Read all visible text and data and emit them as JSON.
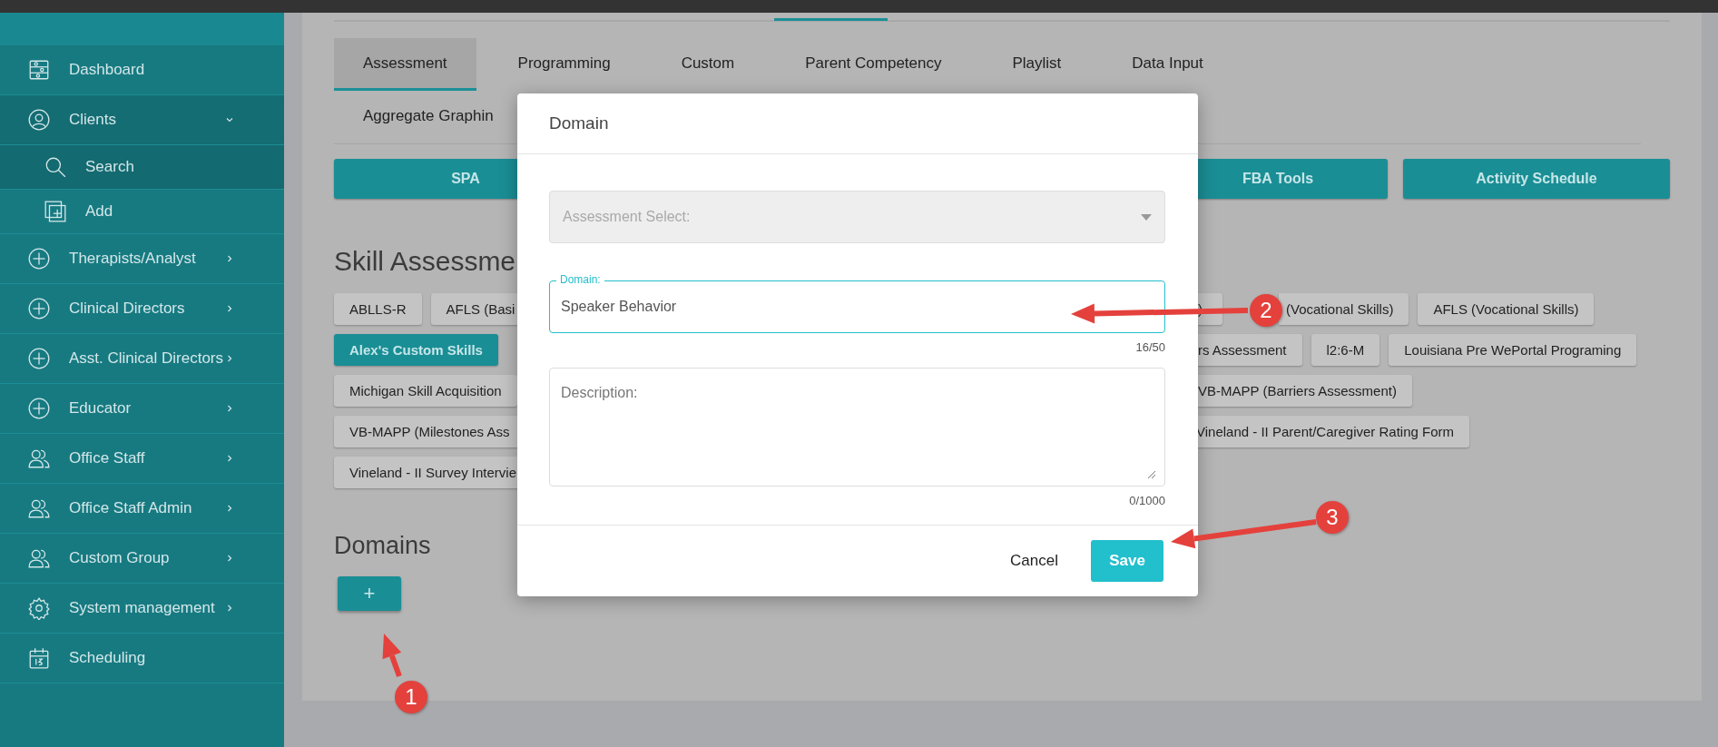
{
  "sidebar": {
    "items": [
      {
        "label": "Dashboard"
      },
      {
        "label": "Clients",
        "expanded": true,
        "children": [
          {
            "label": "Search",
            "selected": true
          },
          {
            "label": "Add",
            "selected": false
          }
        ]
      },
      {
        "label": "Therapists/Analyst",
        "expanded": false
      },
      {
        "label": "Clinical Directors",
        "expanded": false
      },
      {
        "label": "Asst. Clinical Directors",
        "expanded": false
      },
      {
        "label": "Educator",
        "expanded": false
      },
      {
        "label": "Office Staff",
        "expanded": false
      },
      {
        "label": "Office Staff Admin",
        "expanded": false
      },
      {
        "label": "Custom Group",
        "expanded": false
      },
      {
        "label": "System management",
        "expanded": false
      },
      {
        "label": "Scheduling"
      }
    ]
  },
  "tabs": [
    {
      "label": "Assessment",
      "selected": true
    },
    {
      "label": "Programming",
      "selected": false
    },
    {
      "label": "Custom",
      "selected": false
    },
    {
      "label": "Parent Competency",
      "selected": false
    },
    {
      "label": "Playlist",
      "selected": false
    },
    {
      "label": "Data Input",
      "selected": false
    },
    {
      "label": "Aggregate Graphin",
      "selected": false
    }
  ],
  "tool_buttons": [
    "SPA",
    "FBA Tools",
    "Activity Schedule"
  ],
  "skill_assessment": {
    "title": "Skill Assessme",
    "rows": [
      {
        "left": [
          {
            "label": "ABLLS-R",
            "selected": false
          },
          {
            "label": "AFLS (Basi",
            "selected": false
          }
        ],
        "right": [
          {
            "label": ")",
            "selected": false
          },
          {
            "label": "(Vocational Skills)",
            "selected": false
          },
          {
            "label": "AFLS (Vocational Skills)",
            "selected": false
          }
        ]
      },
      {
        "left": [
          {
            "label": "Alex's Custom Skills",
            "selected": true
          }
        ],
        "right": [
          {
            "label": "rs Assessment",
            "selected": false
          },
          {
            "label": "l2:6-M",
            "selected": false
          },
          {
            "label": "Louisiana Pre WePortal Programing",
            "selected": false
          }
        ]
      },
      {
        "left": [
          {
            "label": "Michigan Skill Acquisition",
            "selected": false
          }
        ],
        "right": [
          {
            "label": "VB-MAPP (Barriers Assessment)",
            "selected": false
          }
        ]
      },
      {
        "left": [
          {
            "label": "VB-MAPP (Milestones Ass",
            "selected": false
          }
        ],
        "right": [
          {
            "label": "Vineland - II Parent/Caregiver Rating Form",
            "selected": false
          }
        ]
      },
      {
        "left": [
          {
            "label": "Vineland - II Survey Intervie",
            "selected": false
          }
        ],
        "right": []
      }
    ]
  },
  "domains": {
    "title": "Domains",
    "add_button": "+"
  },
  "modal": {
    "title": "Domain",
    "assessment_select": {
      "placeholder": "Assessment Select:",
      "disabled": true
    },
    "domain_field": {
      "label": "Domain:",
      "value": "Speaker Behavior",
      "counter": "16/50"
    },
    "description_field": {
      "placeholder": "Description:",
      "counter": "0/1000"
    },
    "buttons": {
      "cancel": "Cancel",
      "save": "Save"
    }
  },
  "annotations": [
    {
      "number": "1"
    },
    {
      "number": "2"
    },
    {
      "number": "3"
    }
  ]
}
